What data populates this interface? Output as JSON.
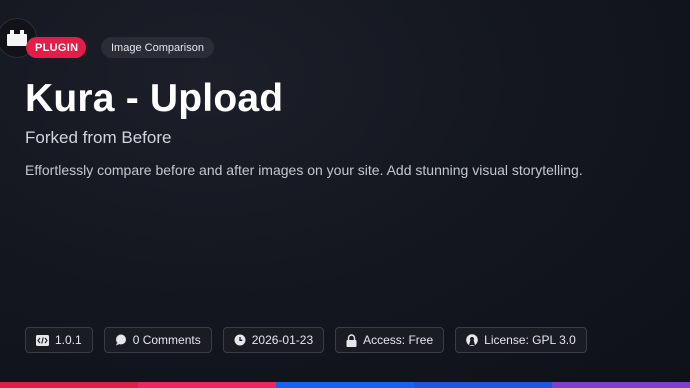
{
  "badges": {
    "type": "PLUGIN",
    "category": "Image Comparison"
  },
  "title": "Kura - Upload",
  "subtitle": "Forked from Before",
  "description": "Effortlessly compare before and after images on your site. Add stunning visual storytelling.",
  "meta": {
    "version": "1.0.1",
    "comments": "0 Comments",
    "date": "2026-01-23",
    "access": "Access: Free",
    "license": "License: GPL 3.0"
  },
  "icons": {
    "logo": "plugin-block-icon",
    "version": "code-icon",
    "comments": "comment-icon",
    "date": "clock-icon",
    "access": "lock-icon",
    "license": "open-source-icon"
  },
  "colors": {
    "plugin_badge": "#e11d48",
    "bar": [
      "#e11d48",
      "#f0245f",
      "#1463f3",
      "#1d55e0",
      "#7e3fd0"
    ]
  }
}
